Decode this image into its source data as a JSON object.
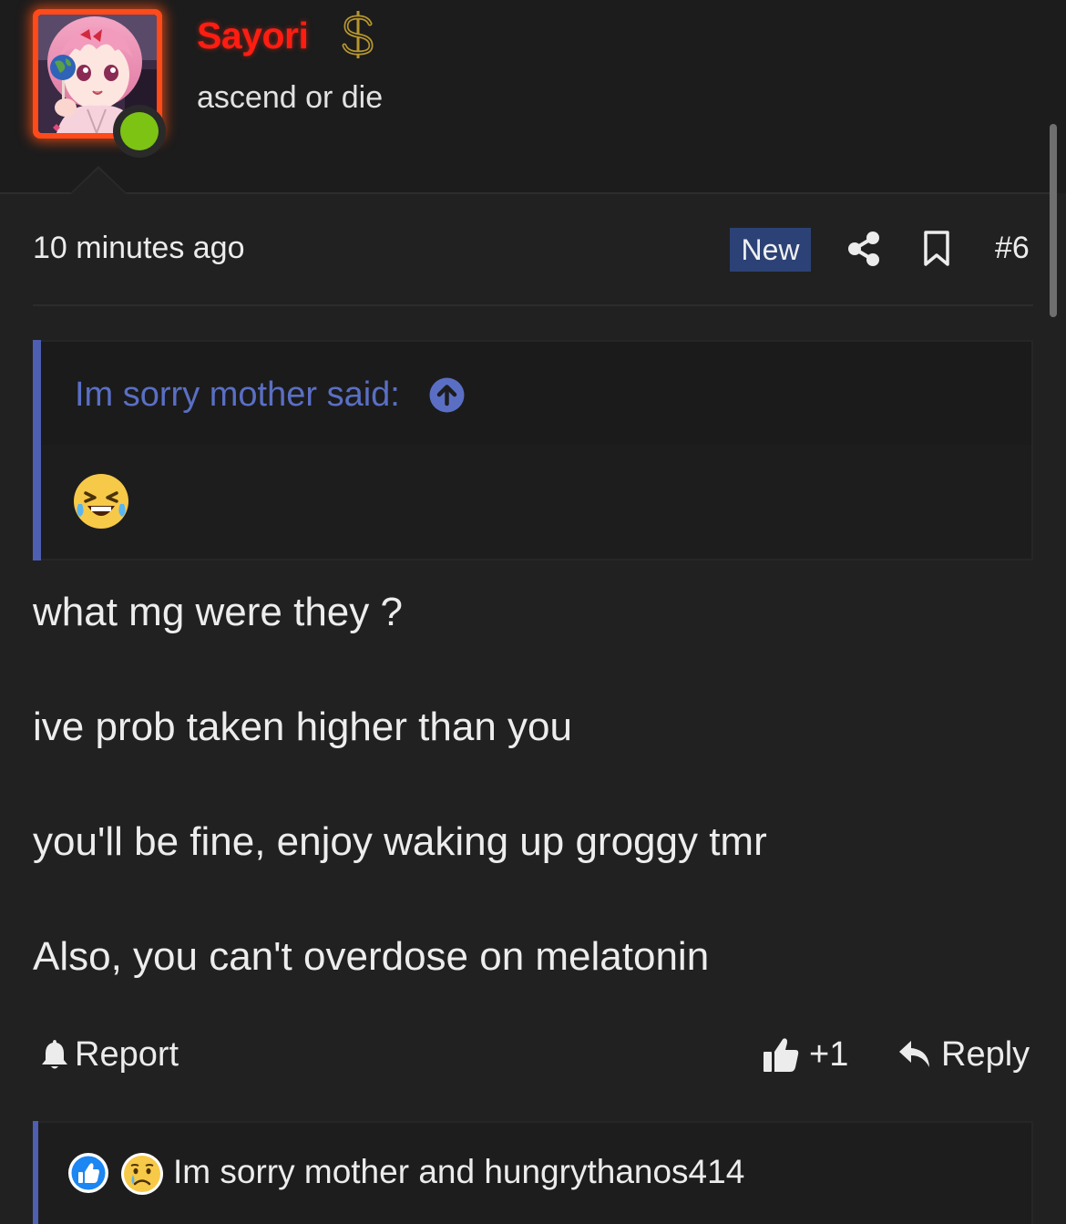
{
  "user": {
    "name": "Sayori",
    "title": "ascend or die",
    "name_color": "#ff1d12",
    "online_color": "#7cc314",
    "badge_icon": "dollar-sign-icon"
  },
  "post": {
    "time": "10 minutes ago",
    "new_label": "New",
    "number": "#6",
    "share_icon": "share-icon",
    "bookmark_icon": "bookmark-icon"
  },
  "quote": {
    "author_line": "Im sorry mother said:",
    "arrow_icon": "arrow-up-circle-icon",
    "content_icon": "laughing-tears-emoji-icon"
  },
  "body": {
    "lines": [
      "what mg were they ?",
      "ive prob taken higher than you",
      "you'll be fine, enjoy waking up groggy tmr",
      "Also, you can't overdose on melatonin"
    ]
  },
  "actions": {
    "report_label": "Report",
    "like_label": "+1",
    "reply_label": "Reply"
  },
  "reactions": {
    "text": "Im sorry mother and hungrythanos414",
    "icons": [
      "like-reaction-icon",
      "sad-reaction-icon"
    ]
  },
  "colors": {
    "background": "#212121",
    "accent_blue": "#4e5eb0",
    "quote_author": "#5a6fc4",
    "new_badge": "#2c4277"
  }
}
